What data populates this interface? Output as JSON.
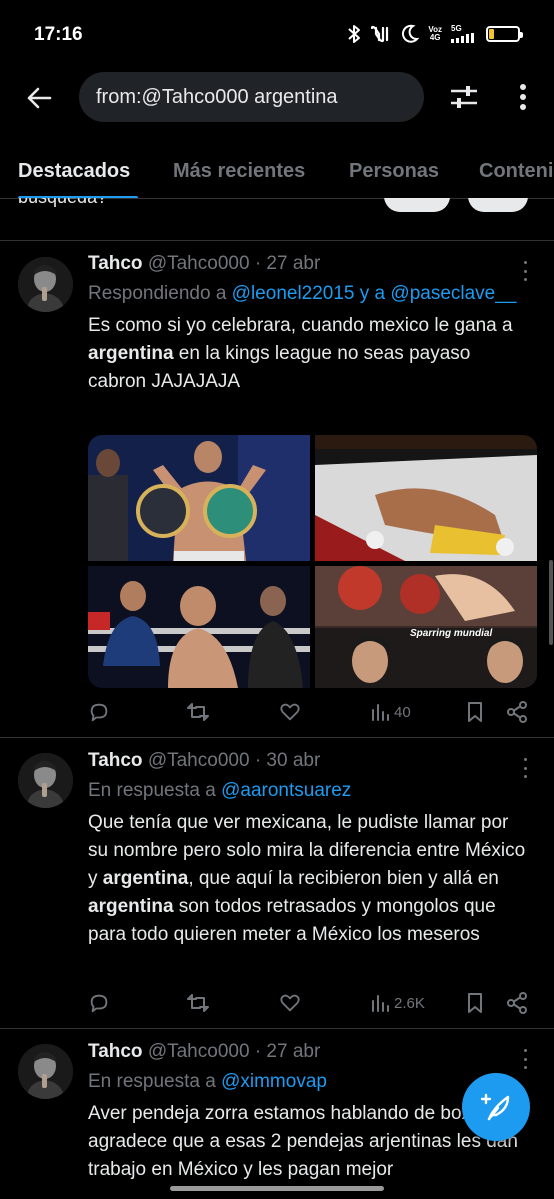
{
  "status_bar": {
    "time": "17:16",
    "network_voz": "Voz",
    "network_4g": "4G",
    "network_5g": "5G",
    "battery": "17",
    "battery_level": 0.17,
    "icons": [
      "bluetooth-icon",
      "nfc-icon",
      "moon-icon",
      "signal-icon",
      "battery-icon"
    ]
  },
  "search": {
    "query": "from:@Tahco000 argentina"
  },
  "tabs": [
    "Destacados",
    "Más recientes",
    "Personas",
    "Contenido multimedia"
  ],
  "active_tab": 0,
  "prev_fragment": "búsqueda?",
  "tweets": [
    {
      "name": "Tahco",
      "handle": "@Tahco000",
      "dot": "·",
      "date": "27 abr",
      "reply_prefix": "Respondiendo a",
      "reply_mentions": "@leonel22015 y a @paseclave__",
      "text_parts": [
        "Es como si yo celebrara, cuando mexico le gana a ",
        "argentina",
        " en la kings league no seas payaso cabron JAJAJAJA"
      ],
      "has_media": true,
      "media_caption": "Sparring mundial",
      "views": "40"
    },
    {
      "name": "Tahco",
      "handle": "@Tahco000",
      "dot": "·",
      "date": "30 abr",
      "reply_prefix": "En respuesta a",
      "reply_mentions": "@aarontsuarez",
      "text_parts": [
        "Que tenía que ver mexicana, le pudiste llamar por su nombre pero solo mira la diferencia entre México y ",
        "argentina",
        ", que aquí la recibieron bien y allá en ",
        "argentina",
        " son todos retrasados y mongolos que para todo quieren meter a México los meseros"
      ],
      "has_media": false,
      "views": "2.6K"
    },
    {
      "name": "Tahco",
      "handle": "@Tahco000",
      "dot": "·",
      "date": "27 abr",
      "reply_prefix": "En respuesta a",
      "reply_mentions": "@ximmovap",
      "text_parts": [
        "Aver pendeja zorra estamos hablando de boxeo y agradece que a esas 2 pendejas arjentinas les dan trabajo en México y les pagan mejor"
      ],
      "has_media": false,
      "views": ""
    }
  ],
  "colors": {
    "background": "#000000",
    "accent": "#1d9bf0",
    "muted": "#71767b",
    "text": "#e7e9ea",
    "divider": "#2f3336",
    "search_bg": "#202327"
  }
}
